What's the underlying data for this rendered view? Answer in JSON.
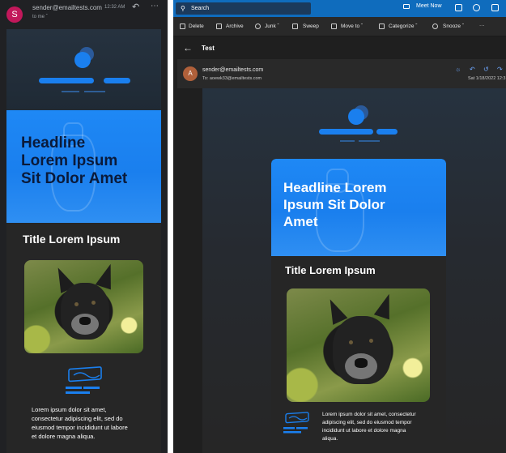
{
  "mobile": {
    "avatar_initial": "S",
    "sender": "sender@emailtests.com",
    "time": "12:32 AM",
    "to_line": "to me",
    "hero_headline_lines": [
      "Headline",
      "Lorem Ipsum",
      "Sit Dolor Amet"
    ],
    "title": "Title Lorem Ipsum",
    "body_lines": [
      "Lorem ipsum dolor sit amet,",
      "consectetur adipiscing elit, sed do",
      "eiusmod tempor incididunt ut labore",
      "et dolore magna aliqua."
    ]
  },
  "desktop": {
    "search_placeholder": "Search",
    "meet_now": "Meet Now",
    "commands": {
      "delete": "Delete",
      "archive": "Archive",
      "junk": "Junk",
      "sweep": "Sweep",
      "move_to": "Move to",
      "categorize": "Categorize",
      "snooze": "Snooze",
      "more": "···"
    },
    "subject": "Test",
    "avatar_initial": "A",
    "sender": "sender@emailtests.com",
    "to_line": "To:  aoewk33@emailtests.com",
    "date": "Sat 1/18/2022 12:3",
    "hero_headline_lines": [
      "Headline Lorem",
      "Ipsum Sit Dolor",
      "Amet"
    ],
    "title": "Title Lorem Ipsum",
    "body_lines": [
      "Lorem ipsum dolor sit amet, consectetur",
      "adipiscing elit, sed do eiusmod tempor",
      "incididunt ut labore et dolore magna",
      "aliqua."
    ]
  },
  "colors": {
    "brand_blue": "#1a7fee",
    "outlook_blue": "#0f6cbd",
    "mobile_bg": "#202124",
    "avatar_mobile": "#c2185b",
    "avatar_desktop": "#b0603a"
  },
  "icons": [
    "reply-icon",
    "more-icon",
    "search-icon",
    "video-icon",
    "back-arrow-icon",
    "sun-icon",
    "reply-all-icon",
    "forward-icon",
    "logo-icon",
    "card-icon"
  ]
}
